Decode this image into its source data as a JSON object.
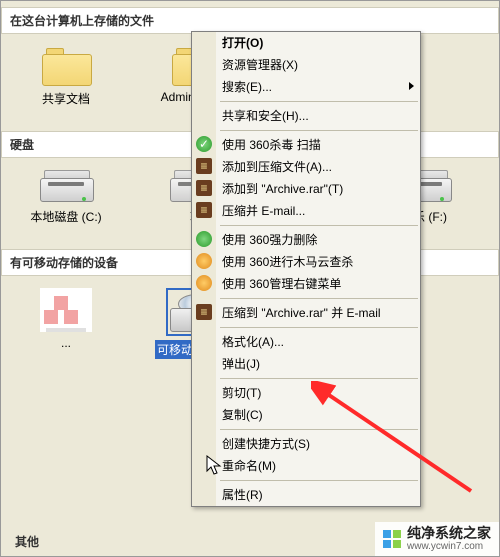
{
  "sections": {
    "files": {
      "title": "在这台计算机上存储的文件",
      "items": [
        {
          "label": "共享文档"
        },
        {
          "label": "Administrator"
        }
      ]
    },
    "drives": {
      "title": "硬盘",
      "items": [
        {
          "label": "本地磁盘 (C:)"
        },
        {
          "label": "软件 (D:)",
          "short": "软"
        },
        {
          "label": "娱乐 (F:)"
        }
      ]
    },
    "removable": {
      "title": "有可移动存储的设备",
      "items": [
        {
          "label": "..."
        },
        {
          "label": "可移动磁盘 (I:)"
        }
      ]
    },
    "other_cut": "其他"
  },
  "context_menu": [
    {
      "kind": "item",
      "label": "打开(O)",
      "bold": true
    },
    {
      "kind": "item",
      "label": "资源管理器(X)"
    },
    {
      "kind": "item",
      "label": "搜索(E)...",
      "submenu": true
    },
    {
      "kind": "sep"
    },
    {
      "kind": "item",
      "label": "共享和安全(H)..."
    },
    {
      "kind": "sep"
    },
    {
      "kind": "item",
      "label": "使用 360杀毒 扫描",
      "icon": "shield"
    },
    {
      "kind": "item",
      "label": "添加到压缩文件(A)...",
      "icon": "rar"
    },
    {
      "kind": "item",
      "label": "添加到 \"Archive.rar\"(T)",
      "icon": "rar"
    },
    {
      "kind": "item",
      "label": "压缩并 E-mail...",
      "icon": "rar"
    },
    {
      "kind": "sep"
    },
    {
      "kind": "item",
      "label": "使用 360强力删除",
      "icon": "qing"
    },
    {
      "kind": "item",
      "label": "使用 360进行木马云查杀",
      "icon": "orange"
    },
    {
      "kind": "item",
      "label": "使用 360管理右键菜单",
      "icon": "orange"
    },
    {
      "kind": "sep"
    },
    {
      "kind": "item",
      "label": "压缩到 \"Archive.rar\" 并 E-mail",
      "icon": "rar"
    },
    {
      "kind": "sep"
    },
    {
      "kind": "item",
      "label": "格式化(A)..."
    },
    {
      "kind": "item",
      "label": "弹出(J)"
    },
    {
      "kind": "sep"
    },
    {
      "kind": "item",
      "label": "剪切(T)"
    },
    {
      "kind": "item",
      "label": "复制(C)"
    },
    {
      "kind": "sep"
    },
    {
      "kind": "item",
      "label": "创建快捷方式(S)"
    },
    {
      "kind": "item",
      "label": "重命名(M)"
    },
    {
      "kind": "sep"
    },
    {
      "kind": "item",
      "label": "属性(R)"
    }
  ],
  "watermark": {
    "name": "纯净系统之家",
    "url": "www.ycwin7.com"
  }
}
